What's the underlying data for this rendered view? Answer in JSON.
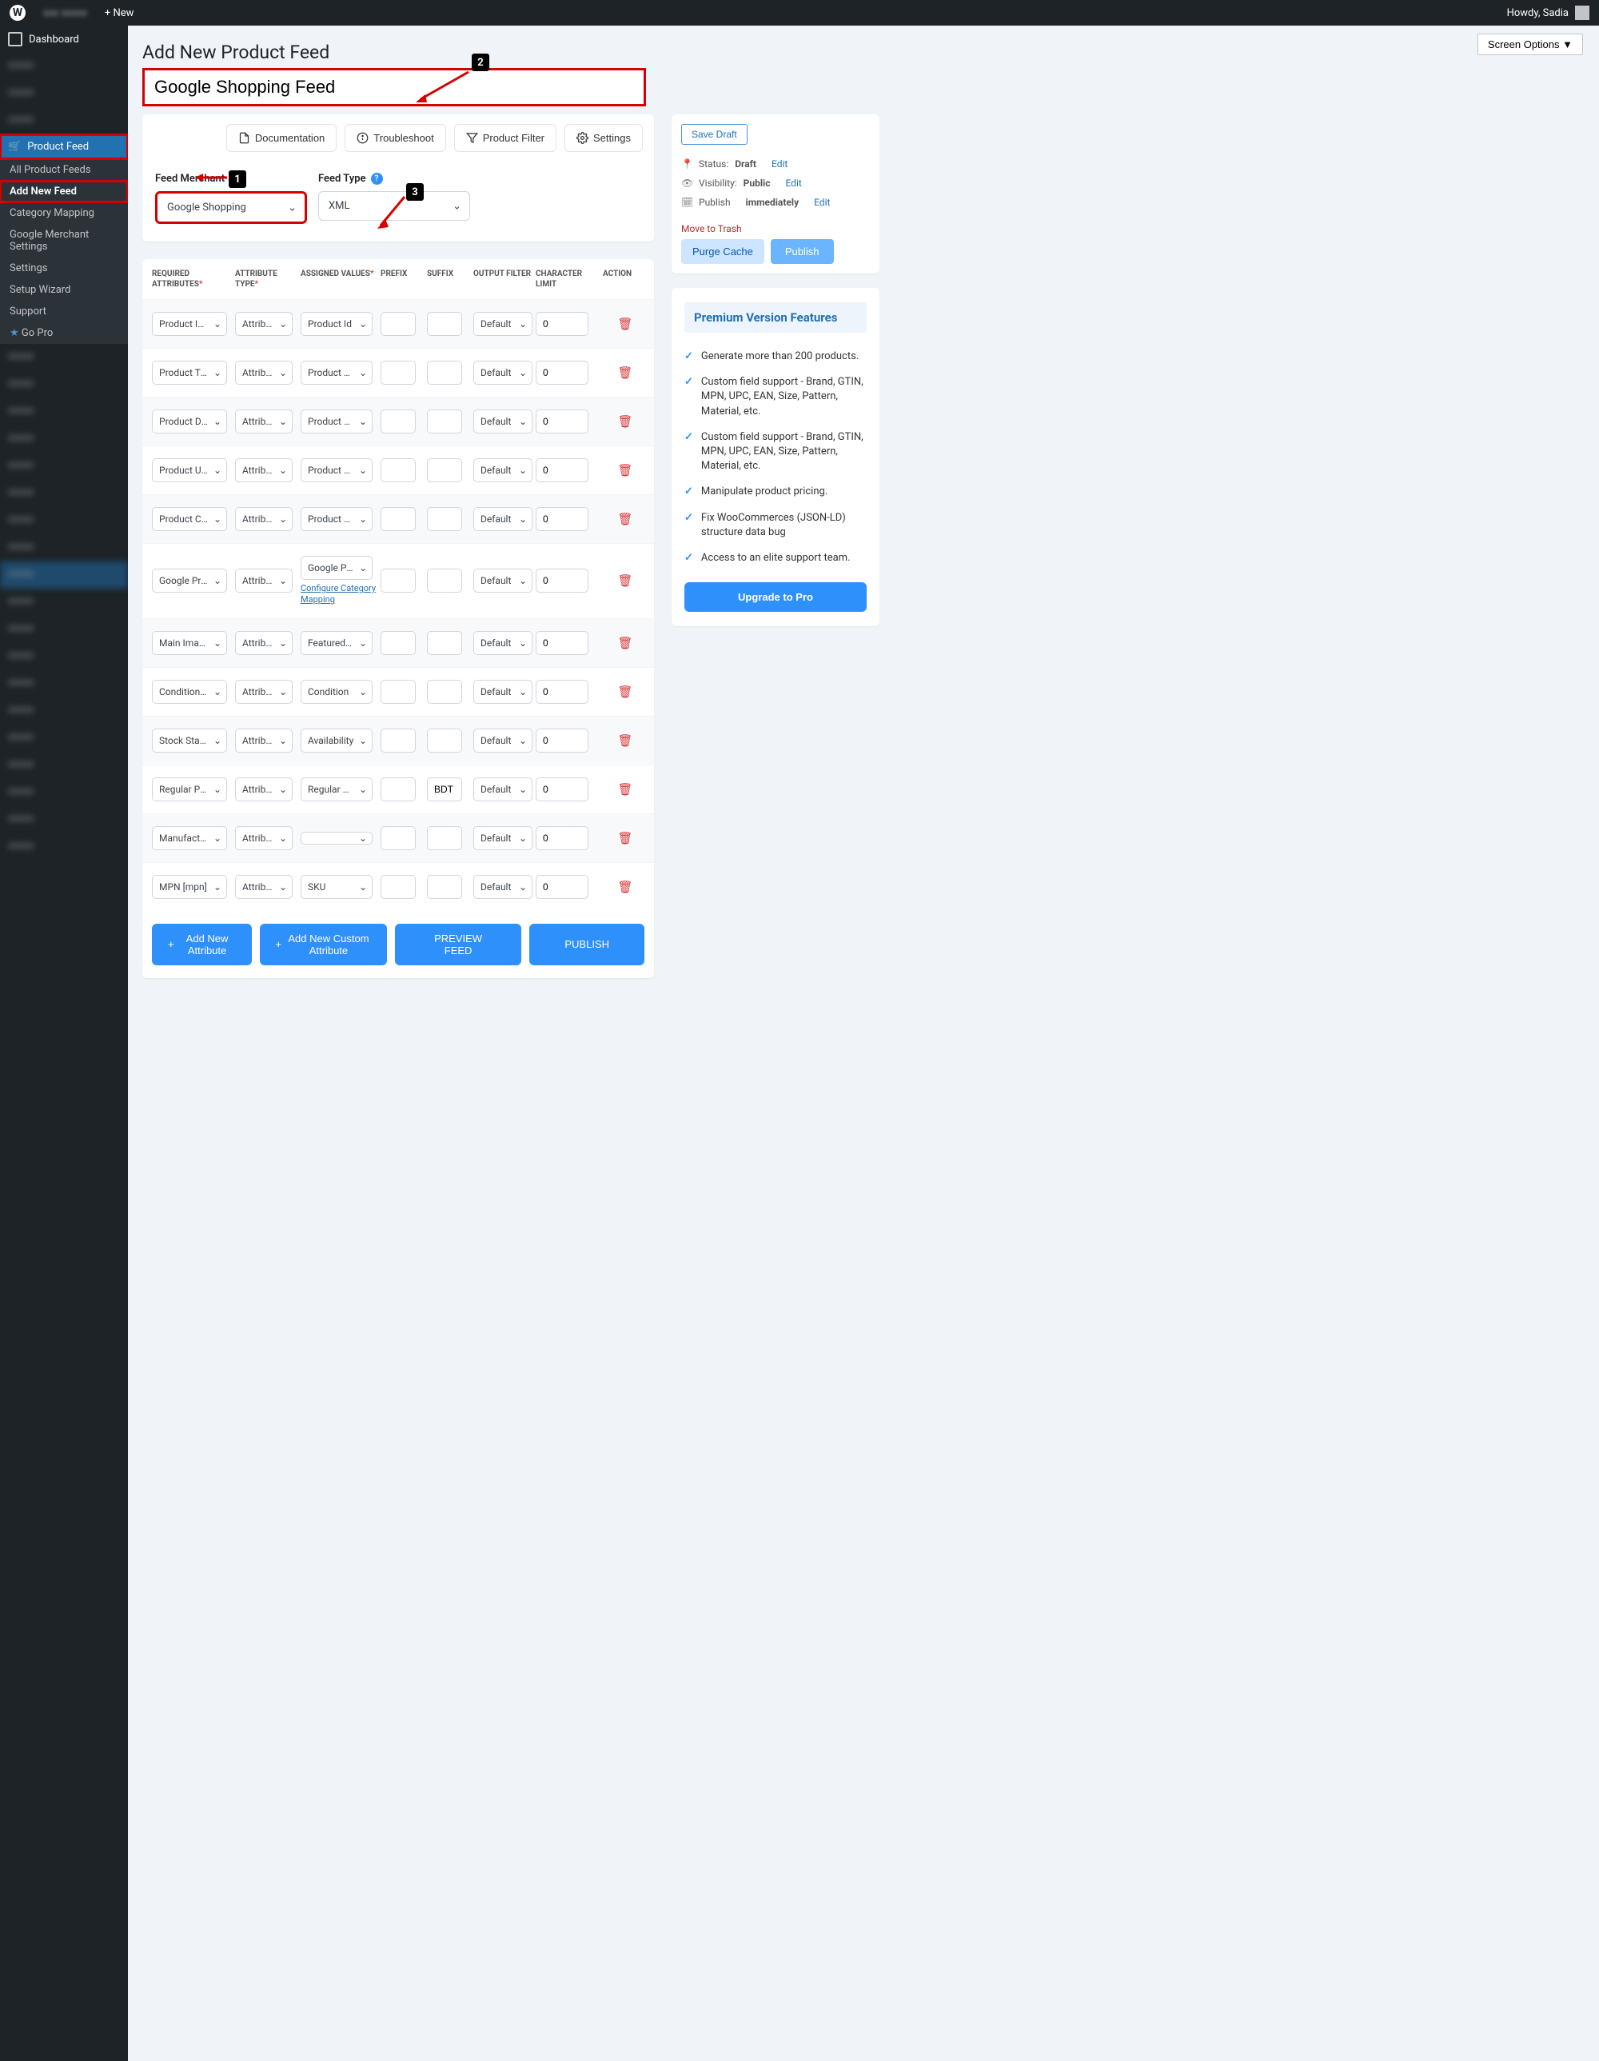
{
  "adminbar": {
    "new_label": "New",
    "howdy": "Howdy, Sadia"
  },
  "sidebar": {
    "dashboard": "Dashboard",
    "product_feed": "Product Feed",
    "sub": {
      "all": "All Product Feeds",
      "add": "Add New Feed",
      "catmap": "Category Mapping",
      "gmerchant": "Google Merchant Settings",
      "settings": "Settings",
      "wizard": "Setup Wizard",
      "support": "Support",
      "gopro": "Go Pro"
    }
  },
  "screen_options": "Screen Options ▼",
  "page_title": "Add New Product Feed",
  "feed_title": "Google Shopping Feed",
  "pills": {
    "doc": "Documentation",
    "trouble": "Troubleshoot",
    "filter": "Product Filter",
    "settings": "Settings"
  },
  "fm": {
    "merchant_label": "Feed Merchant",
    "merchant_value": "Google Shopping",
    "type_label": "Feed Type",
    "type_value": "XML"
  },
  "thead": {
    "req": "REQUIRED ATTRIBUTES",
    "atype": "ATTRIBUTE TYPE",
    "assigned": "ASSIGNED VALUES",
    "prefix": "PREFIX",
    "suffix": "SUFFIX",
    "ofilter": "OUTPUT FILTER",
    "climit": "CHARACTER LIMIT",
    "action": "ACTION"
  },
  "rows": [
    {
      "req": "Product Id [id]",
      "atype": "Attribute",
      "assigned": "Product Id",
      "prefix": "",
      "suffix": "",
      "filter": "Default",
      "climit": "0"
    },
    {
      "req": "Product Title [title]",
      "atype": "Attribute",
      "assigned": "Product Title",
      "prefix": "",
      "suffix": "",
      "filter": "Default",
      "climit": "0"
    },
    {
      "req": "Product Description",
      "atype": "Attribute",
      "assigned": "Product Desc",
      "prefix": "",
      "suffix": "",
      "filter": "Default",
      "climit": "0"
    },
    {
      "req": "Product URL [link]",
      "atype": "Attribute",
      "assigned": "Product URL",
      "prefix": "",
      "suffix": "",
      "filter": "Default",
      "climit": "0"
    },
    {
      "req": "Product Category",
      "atype": "Attribute",
      "assigned": "Product Cate",
      "prefix": "",
      "suffix": "",
      "filter": "Default",
      "climit": "0"
    },
    {
      "req": "Google Product",
      "atype": "Attribute",
      "assigned": "Google Produ",
      "prefix": "",
      "suffix": "",
      "filter": "Default",
      "climit": "0",
      "cfg": "Configure Category Mapping"
    },
    {
      "req": "Main Image [image_link]",
      "atype": "Attribute",
      "assigned": "Featured Ima",
      "prefix": "",
      "suffix": "",
      "filter": "Default",
      "climit": "0"
    },
    {
      "req": "Condition [condition]",
      "atype": "Attribute",
      "assigned": "Condition",
      "prefix": "",
      "suffix": "",
      "filter": "Default",
      "climit": "0"
    },
    {
      "req": "Stock Status [availability]",
      "atype": "Attribute",
      "assigned": "Availability",
      "prefix": "",
      "suffix": "",
      "filter": "Default",
      "climit": "0"
    },
    {
      "req": "Regular Price [price]",
      "atype": "Attribute",
      "assigned": "Regular Price",
      "prefix": "",
      "suffix": "BDT",
      "filter": "Default",
      "climit": "0"
    },
    {
      "req": "Manufacturer [brand]",
      "atype": "Attribute",
      "assigned": "",
      "prefix": "",
      "suffix": "",
      "filter": "Default",
      "climit": "0"
    },
    {
      "req": "MPN [mpn]",
      "atype": "Attribute",
      "assigned": "SKU",
      "prefix": "",
      "suffix": "",
      "filter": "Default",
      "climit": "0"
    }
  ],
  "bottom": {
    "add_attr": "Add New Attribute",
    "add_custom": "Add New Custom Attribute",
    "preview": "PREVIEW FEED",
    "publish": "PUBLISH"
  },
  "publish_box": {
    "save_draft": "Save Draft",
    "status_lbl": "Status:",
    "status_val": "Draft",
    "vis_lbl": "Visibility:",
    "vis_val": "Public",
    "pub_lbl": "Publish",
    "immediately": "immediately",
    "edit": "Edit",
    "trash": "Move to Trash",
    "purge": "Purge Cache",
    "publish": "Publish"
  },
  "premium": {
    "title": "Premium Version Features",
    "items": [
      "Generate more than 200 products.",
      "Custom field support - Brand, GTIN, MPN, UPC, EAN, Size, Pattern, Material, etc.",
      "Custom field support - Brand, GTIN, MPN, UPC, EAN, Size, Pattern, Material, etc.",
      "Manipulate product pricing.",
      "Fix WooCommerces (JSON-LD) structure data bug",
      "Access to an elite support team."
    ],
    "upgrade": "Upgrade to Pro"
  },
  "annotations": {
    "one": "1",
    "two": "2",
    "three": "3"
  }
}
